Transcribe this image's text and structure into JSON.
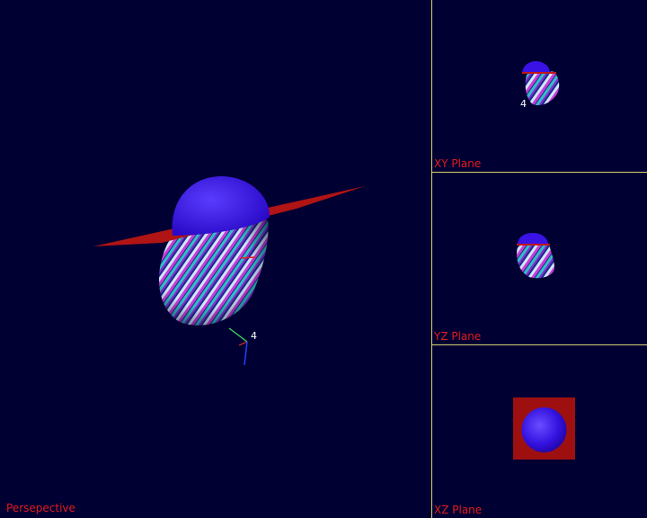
{
  "viewports": {
    "perspective": {
      "label": "Persepective",
      "axis_label": "4"
    },
    "xy": {
      "label": "XY Plane",
      "axis_label": "4"
    },
    "yz": {
      "label": "YZ Plane"
    },
    "xz": {
      "label": "XZ Plane"
    }
  },
  "colors": {
    "background": "#000033",
    "divider": "#d8d070",
    "label": "#e21b1b",
    "hat_dome": "#3a12e6",
    "hat_brim": "#b01414"
  },
  "scene": {
    "objects": [
      "hat-dome",
      "hat-brim",
      "striped-head",
      "axis-gizmo"
    ]
  }
}
